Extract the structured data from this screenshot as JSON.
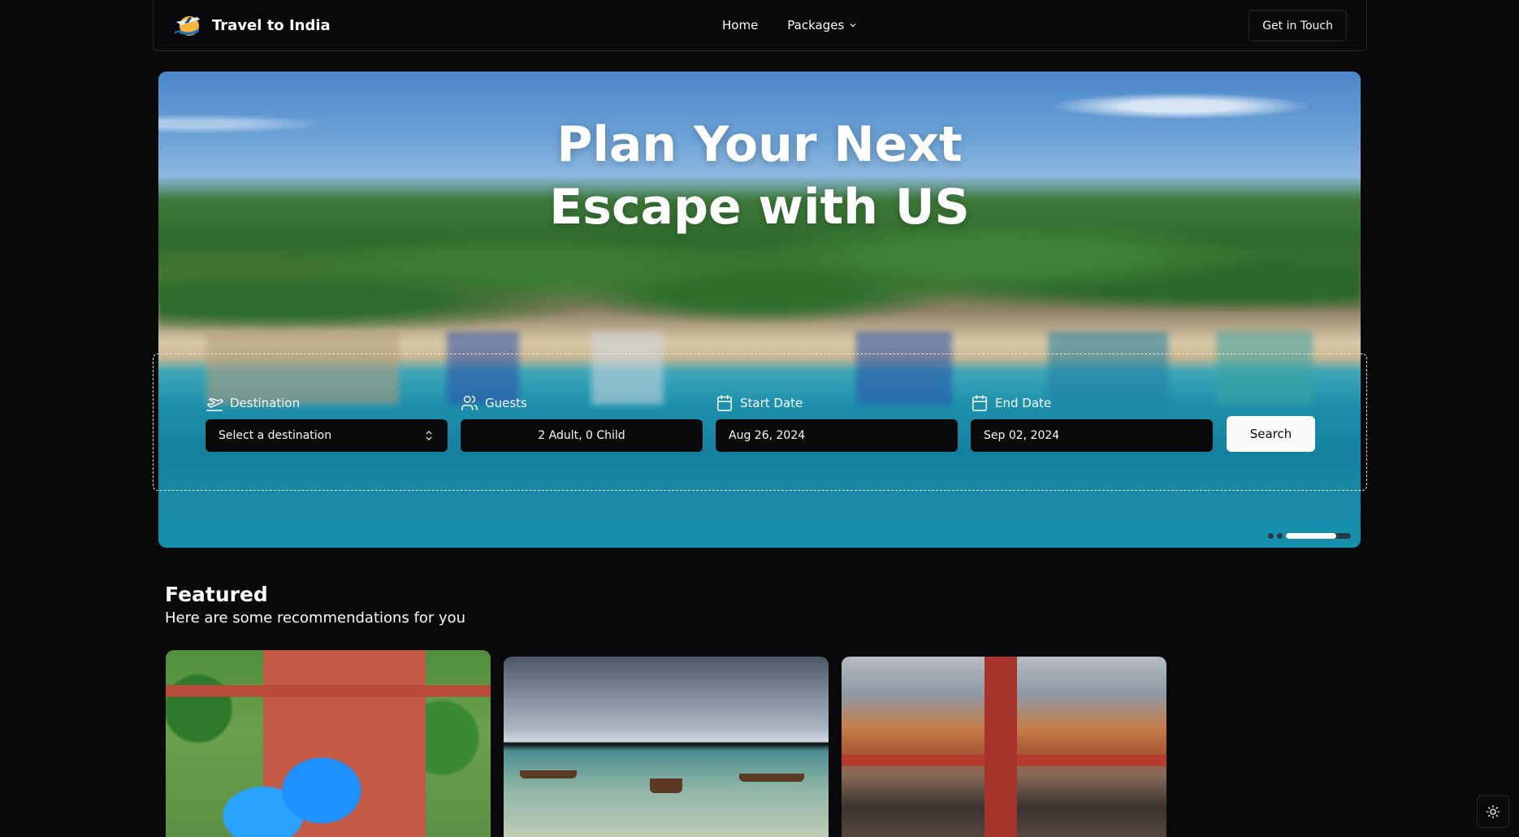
{
  "header": {
    "brand_name": "Travel to India",
    "logo_icon": "travel-logo-icon",
    "nav": [
      {
        "label": "Home"
      },
      {
        "label": "Packages",
        "icon": "chevron-down-icon"
      }
    ],
    "cta_label": "Get in Touch"
  },
  "hero": {
    "title_line1": "Plan Your Next",
    "title_line2": "Escape with US",
    "carousel_progress": 0.78
  },
  "search": {
    "destination": {
      "label": "Destination",
      "icon": "plane-departure-icon",
      "value": "Select a destination"
    },
    "guests": {
      "label": "Guests",
      "icon": "users-icon",
      "value": "2 Adult, 0 Child"
    },
    "start_date": {
      "label": "Start Date",
      "icon": "calendar-icon",
      "value": "Aug 26, 2024"
    },
    "end_date": {
      "label": "End Date",
      "icon": "calendar-icon",
      "value": "Sep 02, 2024"
    },
    "button_label": "Search"
  },
  "featured": {
    "title": "Featured",
    "subtitle": "Here are some recommendations for you"
  },
  "colors": {
    "background": "#09090b",
    "foreground": "#fafafa",
    "border": "#27272a"
  },
  "theme_toggle_icon": "sun-icon"
}
